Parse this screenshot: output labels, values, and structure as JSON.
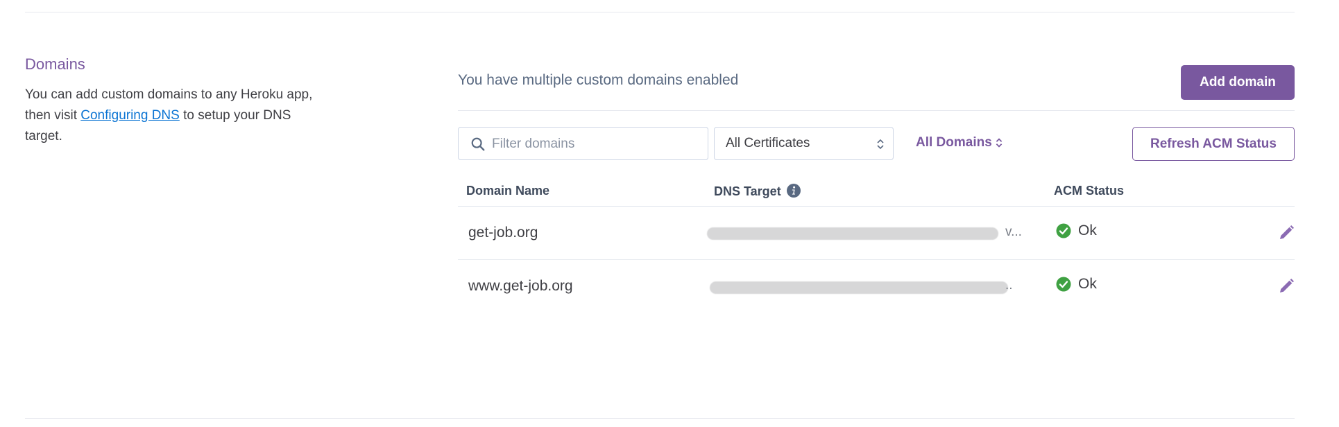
{
  "sidebar": {
    "title": "Domains",
    "description_before": "You can add custom domains to any Heroku app, then visit ",
    "link_text": "Configuring DNS",
    "description_after": " to setup your DNS target."
  },
  "header": {
    "summary": "You have multiple custom domains enabled",
    "add_button": "Add domain"
  },
  "filters": {
    "search_placeholder": "Filter domains",
    "search_value": "",
    "certificate_select": "All Certificates",
    "domains_dropdown": "All Domains",
    "refresh_button": "Refresh ACM Status"
  },
  "table": {
    "columns": [
      "Domain Name",
      "DNS Target",
      "ACM Status"
    ],
    "rows": [
      {
        "domain": "get-job.org",
        "dns_target_suffix": "v...",
        "acm_status": "Ok"
      },
      {
        "domain": "www.get-job.org",
        "dns_target_suffix": "..",
        "acm_status": "Ok"
      }
    ]
  },
  "colors": {
    "accent": "#79589f",
    "link": "#0b74d3",
    "ok": "#3fa142"
  },
  "icons": [
    "search-icon",
    "chevron-updown-icon",
    "info-icon",
    "check-circle-icon",
    "pencil-icon"
  ]
}
